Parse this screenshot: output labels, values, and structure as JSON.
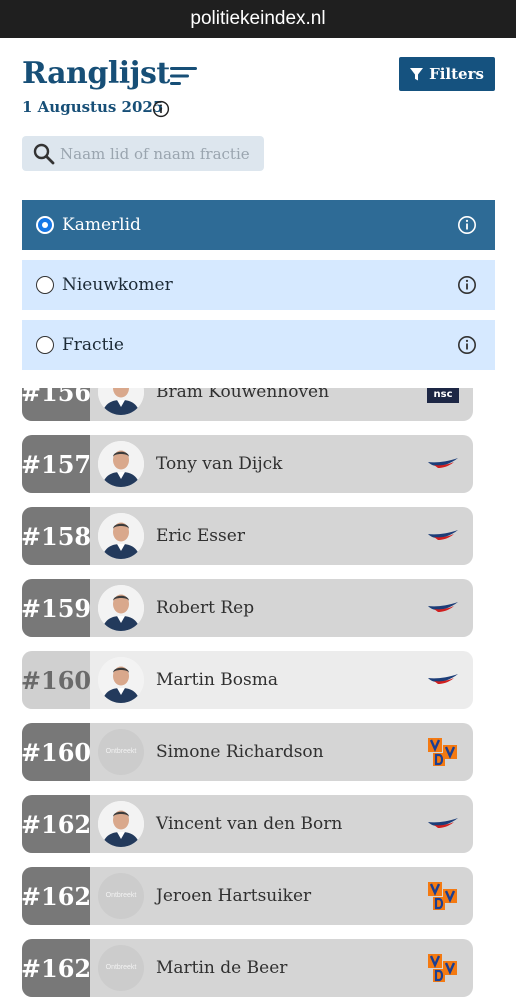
{
  "browser": {
    "url": "politiekeindex.nl"
  },
  "header": {
    "title": "Ranglijst",
    "date": "1 Augustus 2025",
    "filters_label": "Filters"
  },
  "search": {
    "placeholder": "Naam lid of naam fractie"
  },
  "options": [
    {
      "label": "Kamerlid",
      "selected": true
    },
    {
      "label": "Nieuwkomer",
      "selected": false
    },
    {
      "label": "Fractie",
      "selected": false
    }
  ],
  "colors": {
    "primary": "#15527f",
    "selected_option": "#2e6b96",
    "unselected_option": "#d6e9ff"
  },
  "rows": [
    {
      "rank": "#156",
      "name": "Bram Kouwenhoven",
      "party_logo": "nsc-logo",
      "photo": true
    },
    {
      "rank": "#157",
      "name": "Tony van Dijck",
      "party_logo": "pvv-logo",
      "photo": true
    },
    {
      "rank": "#158",
      "name": "Eric Esser",
      "party_logo": "pvv-logo",
      "photo": true
    },
    {
      "rank": "#159",
      "name": "Robert Rep",
      "party_logo": "pvv-logo",
      "photo": true
    },
    {
      "rank": "#160",
      "name": "Martin Bosma",
      "party_logo": "pvv-logo",
      "photo": true,
      "highlight": "light"
    },
    {
      "rank": "#160",
      "name": "Simone Richardson",
      "party_logo": "vvd-logo",
      "photo": false,
      "photo_placeholder": "Ontbreekt"
    },
    {
      "rank": "#162",
      "name": "Vincent van den Born",
      "party_logo": "pvv-logo",
      "photo": true
    },
    {
      "rank": "#162",
      "name": "Jeroen Hartsuiker",
      "party_logo": "vvd-logo",
      "photo": false,
      "photo_placeholder": "Ontbreekt"
    },
    {
      "rank": "#162",
      "name": "Martin de Beer",
      "party_logo": "vvd-logo",
      "photo": false,
      "photo_placeholder": "Ontbreekt"
    }
  ]
}
